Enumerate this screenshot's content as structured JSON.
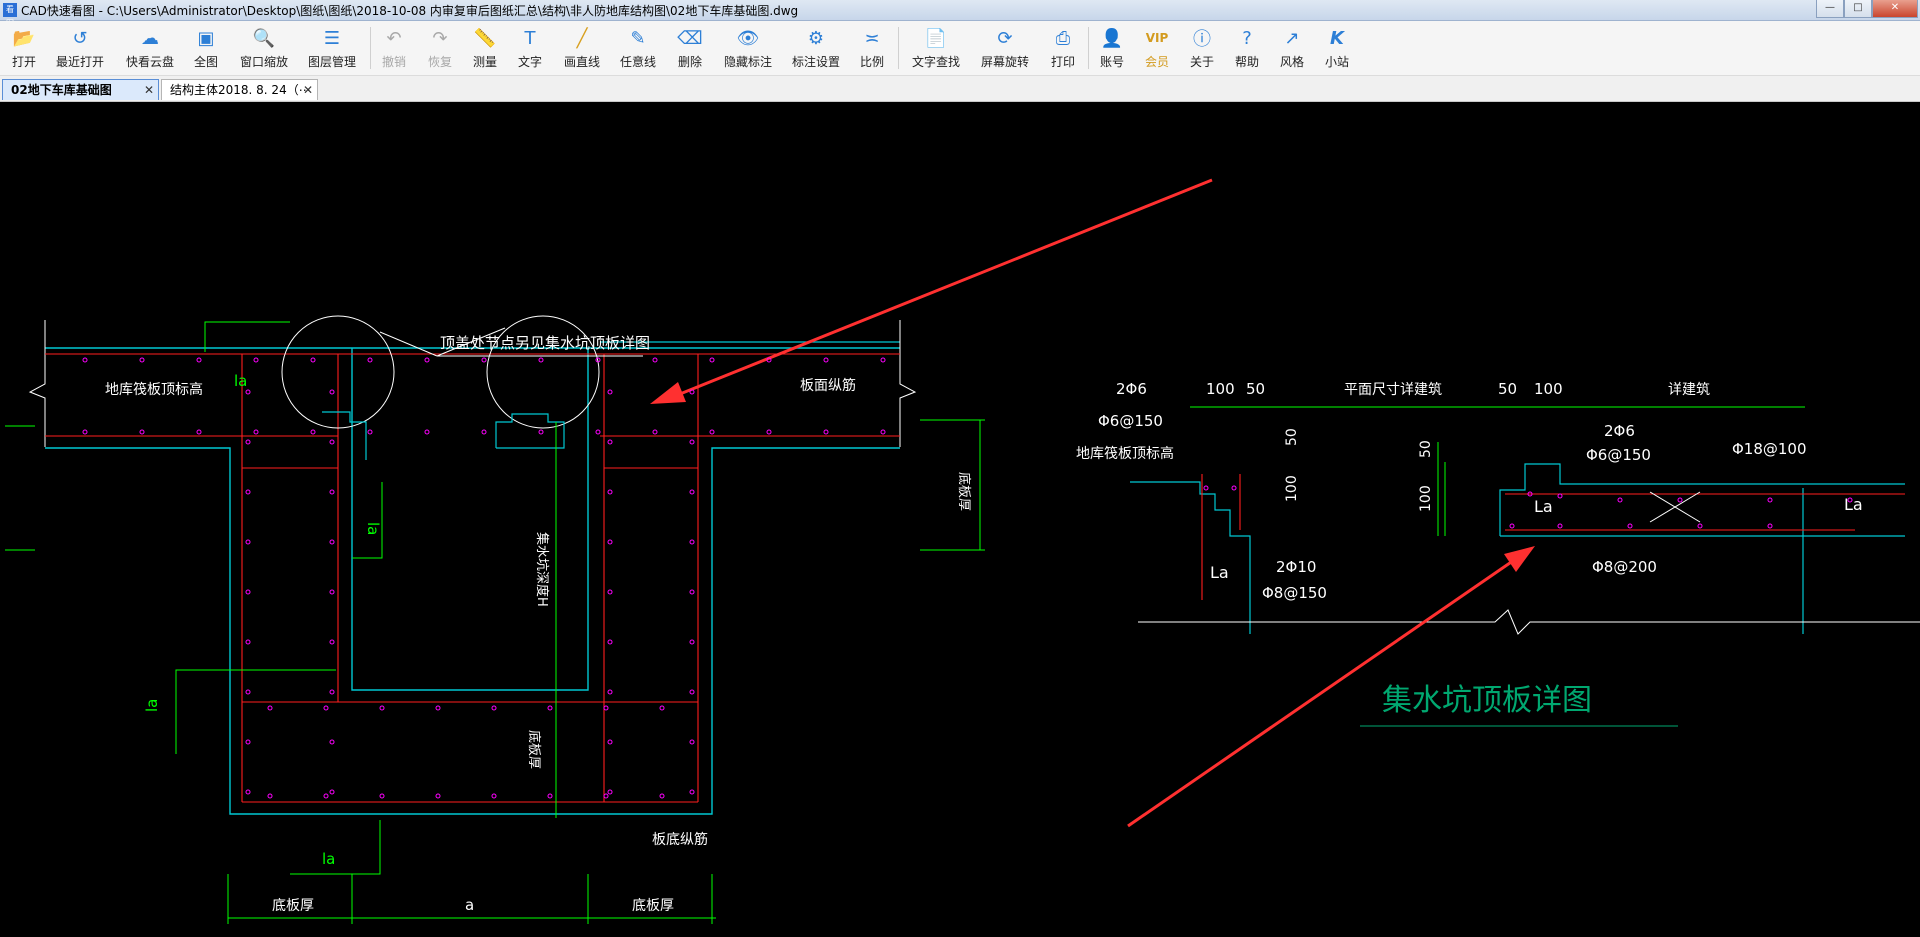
{
  "window": {
    "title": "CAD快速看图 - C:\\Users\\Administrator\\Desktop\\图纸\\图纸\\2018-10-08 内审复审后图纸汇总\\结构\\非人防地库结构图\\02地下车库基础图.dwg",
    "app_icon_text": "看图"
  },
  "window_controls": {
    "minimize": "—",
    "maximize": "□",
    "close": "✕"
  },
  "toolbar": {
    "items": [
      {
        "label": "打开",
        "icon": "folder-open-icon"
      },
      {
        "label": "最近打开",
        "icon": "history-icon"
      },
      {
        "label": "快看云盘",
        "icon": "cloud-icon"
      },
      {
        "label": "全图",
        "icon": "fullview-icon"
      },
      {
        "label": "窗口缩放",
        "icon": "zoom-window-icon"
      },
      {
        "label": "图层管理",
        "icon": "layers-icon"
      },
      {
        "label": "撤销",
        "icon": "undo-icon"
      },
      {
        "label": "恢复",
        "icon": "redo-icon"
      },
      {
        "label": "测量",
        "icon": "ruler-icon"
      },
      {
        "label": "文字",
        "icon": "text-icon"
      },
      {
        "label": "画直线",
        "icon": "line-icon"
      },
      {
        "label": "任意线",
        "icon": "pen-icon"
      },
      {
        "label": "删除",
        "icon": "eraser-icon"
      },
      {
        "label": "隐藏标注",
        "icon": "eye-icon"
      },
      {
        "label": "标注设置",
        "icon": "annotation-settings-icon"
      },
      {
        "label": "比例",
        "icon": "scale-icon"
      },
      {
        "label": "文字查找",
        "icon": "find-text-icon"
      },
      {
        "label": "屏幕旋转",
        "icon": "rotate-icon"
      },
      {
        "label": "打印",
        "icon": "printer-icon"
      },
      {
        "label": "账号",
        "icon": "user-icon"
      },
      {
        "label": "会员",
        "icon": "vip-icon"
      },
      {
        "label": "关于",
        "icon": "info-icon"
      },
      {
        "label": "帮助",
        "icon": "help-icon"
      },
      {
        "label": "风格",
        "icon": "style-icon"
      },
      {
        "label": "小站",
        "icon": "k-logo-icon"
      }
    ]
  },
  "tabs": [
    {
      "label": "02地下车库基础图",
      "active": true,
      "close": "✕"
    },
    {
      "label": "结构主体2018. 8. 24（⋯",
      "active": false,
      "close": "✕"
    }
  ],
  "drawing": {
    "left": {
      "callout": "顶盖处节点另见集水坑顶板详图",
      "slab_top_label": "地库筏板顶标高",
      "top_rebar": "板面纵筋",
      "bottom_rebar": "板底纵筋",
      "slab_thickness": "底板厚",
      "pit_depth": "集水坑深度H",
      "pit_bottom_thickness": "底板厚",
      "la_labels": [
        "la",
        "la",
        "la",
        "la"
      ],
      "dim_labels": [
        "底板厚",
        "a",
        "底板厚"
      ]
    },
    "right": {
      "title": "集水坑顶板详图",
      "left_bar1": "2Φ6",
      "left_bar2": "Φ6@150",
      "right_bar1": "2Φ6",
      "right_bar2": "Φ6@150",
      "slab_top_label": "地库筏板顶标高",
      "dims_top": [
        "100",
        "50",
        "平面尺寸详建筑",
        "50",
        "100",
        "详建筑"
      ],
      "dims_side": [
        "50",
        "100",
        "50",
        "100"
      ],
      "rebar_a": "2Φ10",
      "rebar_b": "Φ8@150",
      "rebar_c": "Φ18@100",
      "rebar_d": "Φ8@200",
      "la_labels": [
        "La",
        "La",
        "La"
      ]
    }
  },
  "colors": {
    "cad_bg": "#000000",
    "concrete": "#00c8d2",
    "rebar": "#ff1e1e",
    "dim": "#00ff00",
    "text": "#ffffff",
    "arrow": "#ff3030",
    "dots": "#ff00ff"
  }
}
